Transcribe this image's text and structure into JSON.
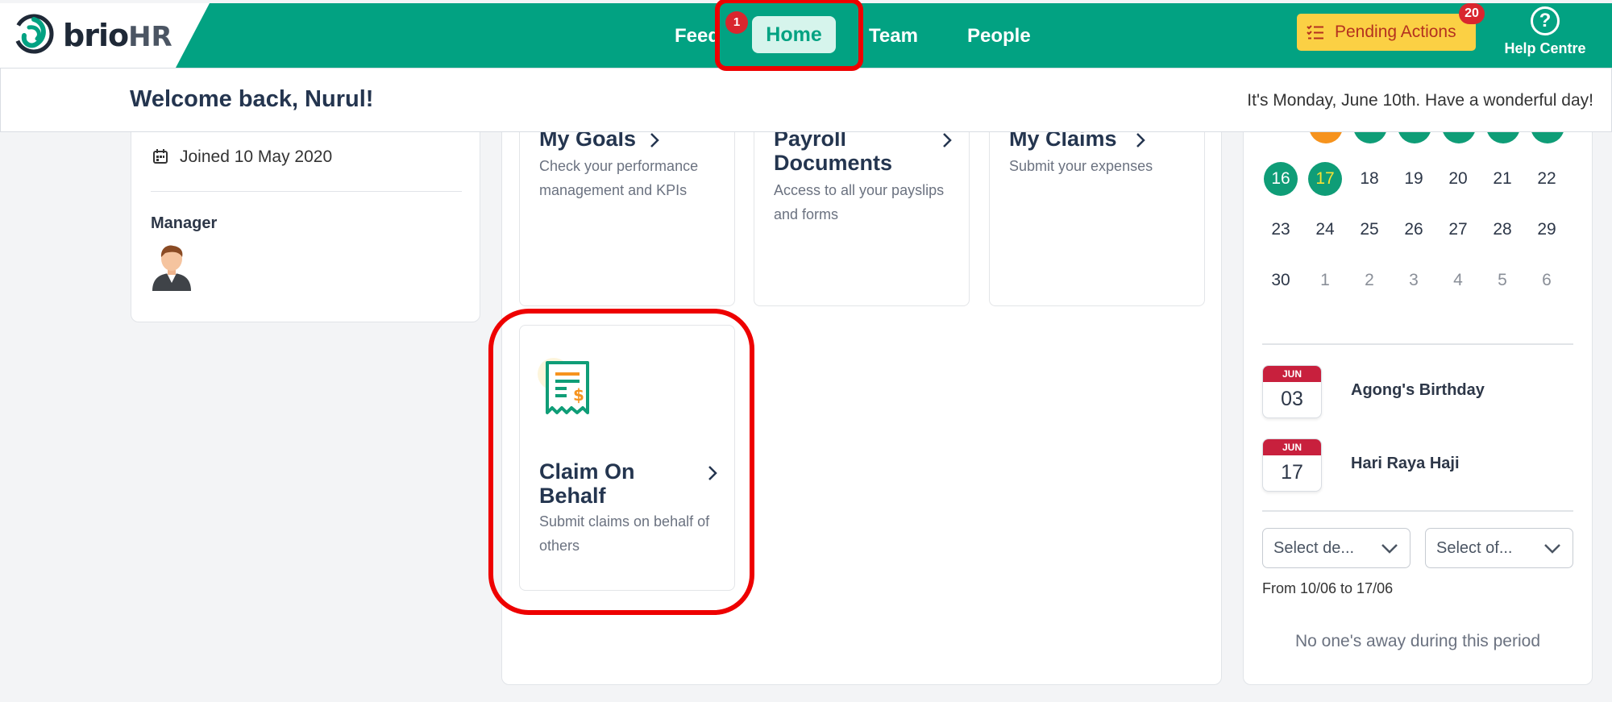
{
  "brand": {
    "name": "brio",
    "suffix": "HR"
  },
  "nav": {
    "items": [
      {
        "label": "Feed"
      },
      {
        "label": "Home"
      },
      {
        "label": "Team"
      },
      {
        "label": "People"
      }
    ],
    "badge": "1",
    "active": "Home"
  },
  "header": {
    "pending_label": "Pending Actions",
    "pending_count": "20",
    "help_label": "Help Centre"
  },
  "welcome": {
    "title": "Welcome back, Nurul!",
    "date_text": "It's Monday, June 10th. Have a wonderful day!"
  },
  "profile": {
    "joined": "Joined 10 May 2020",
    "manager_label": "Manager"
  },
  "tiles": [
    {
      "title": "My Goals",
      "desc": "Check your performance management and KPIs"
    },
    {
      "title": "Payroll Documents",
      "desc": "Access to all your payslips and forms"
    },
    {
      "title": "My Claims",
      "desc": "Submit your expenses"
    },
    {
      "title": "Claim On Behalf",
      "desc": "Submit claims on behalf of others"
    }
  ],
  "calendar": {
    "rows": [
      [
        {
          "d": "16",
          "s": "green"
        },
        {
          "d": "17",
          "s": "green-today"
        },
        {
          "d": "18"
        },
        {
          "d": "19"
        },
        {
          "d": "20"
        },
        {
          "d": "21"
        },
        {
          "d": "22"
        }
      ],
      [
        {
          "d": "23"
        },
        {
          "d": "24"
        },
        {
          "d": "25"
        },
        {
          "d": "26"
        },
        {
          "d": "27"
        },
        {
          "d": "28"
        },
        {
          "d": "29"
        }
      ],
      [
        {
          "d": "30"
        },
        {
          "d": "1",
          "s": "muted"
        },
        {
          "d": "2",
          "s": "muted"
        },
        {
          "d": "3",
          "s": "muted"
        },
        {
          "d": "4",
          "s": "muted"
        },
        {
          "d": "5",
          "s": "muted"
        },
        {
          "d": "6",
          "s": "muted"
        }
      ]
    ]
  },
  "holidays": [
    {
      "month": "JUN",
      "day": "03",
      "name": "Agong's Birthday"
    },
    {
      "month": "JUN",
      "day": "17",
      "name": "Hari Raya Haji"
    }
  ],
  "filters": {
    "department": "Select de...",
    "office": "Select of..."
  },
  "away": {
    "range": "From 10/06 to 17/06",
    "empty": "No one's away during this period"
  },
  "colors": {
    "brand_green": "#02a282",
    "pending_bg": "#fbd044",
    "badge_red": "#d9262e",
    "highlight_red": "#ee0000"
  }
}
